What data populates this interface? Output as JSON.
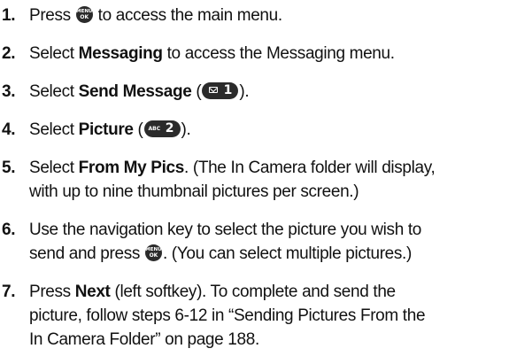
{
  "icons": {
    "menu_key_top": "MENU",
    "menu_key_bottom": "OK",
    "key1_digit": "1",
    "key2_letters": "ABC",
    "key2_digit": "2",
    "key_color": "#2b2b2b"
  },
  "steps": [
    {
      "num": "1.",
      "a": "Press ",
      "b": " to access the main menu."
    },
    {
      "num": "2.",
      "a": "Select ",
      "bold": "Messaging",
      "b": " to access the Messaging menu."
    },
    {
      "num": "3.",
      "a": "Select ",
      "bold": "Send Message",
      "b": " (",
      "c": ")."
    },
    {
      "num": "4.",
      "a": "Select ",
      "bold": "Picture",
      "b": " (",
      "c": ")."
    },
    {
      "num": "5.",
      "a": "Select ",
      "bold": "From My Pics",
      "b": ". (The In Camera folder will display,",
      "line2": "with up to nine thumbnail pictures per screen.)"
    },
    {
      "num": "6.",
      "line1": "Use the navigation key to select the picture you wish to",
      "a": "send and press ",
      "b": ". (You can select multiple pictures.)"
    },
    {
      "num": "7.",
      "a": "Press ",
      "bold": "Next",
      "b": " (left softkey). To complete and send the",
      "line2": "picture, follow steps 6-12 in “Sending Pictures From the",
      "line3": "In Camera Folder” on page 188."
    }
  ]
}
